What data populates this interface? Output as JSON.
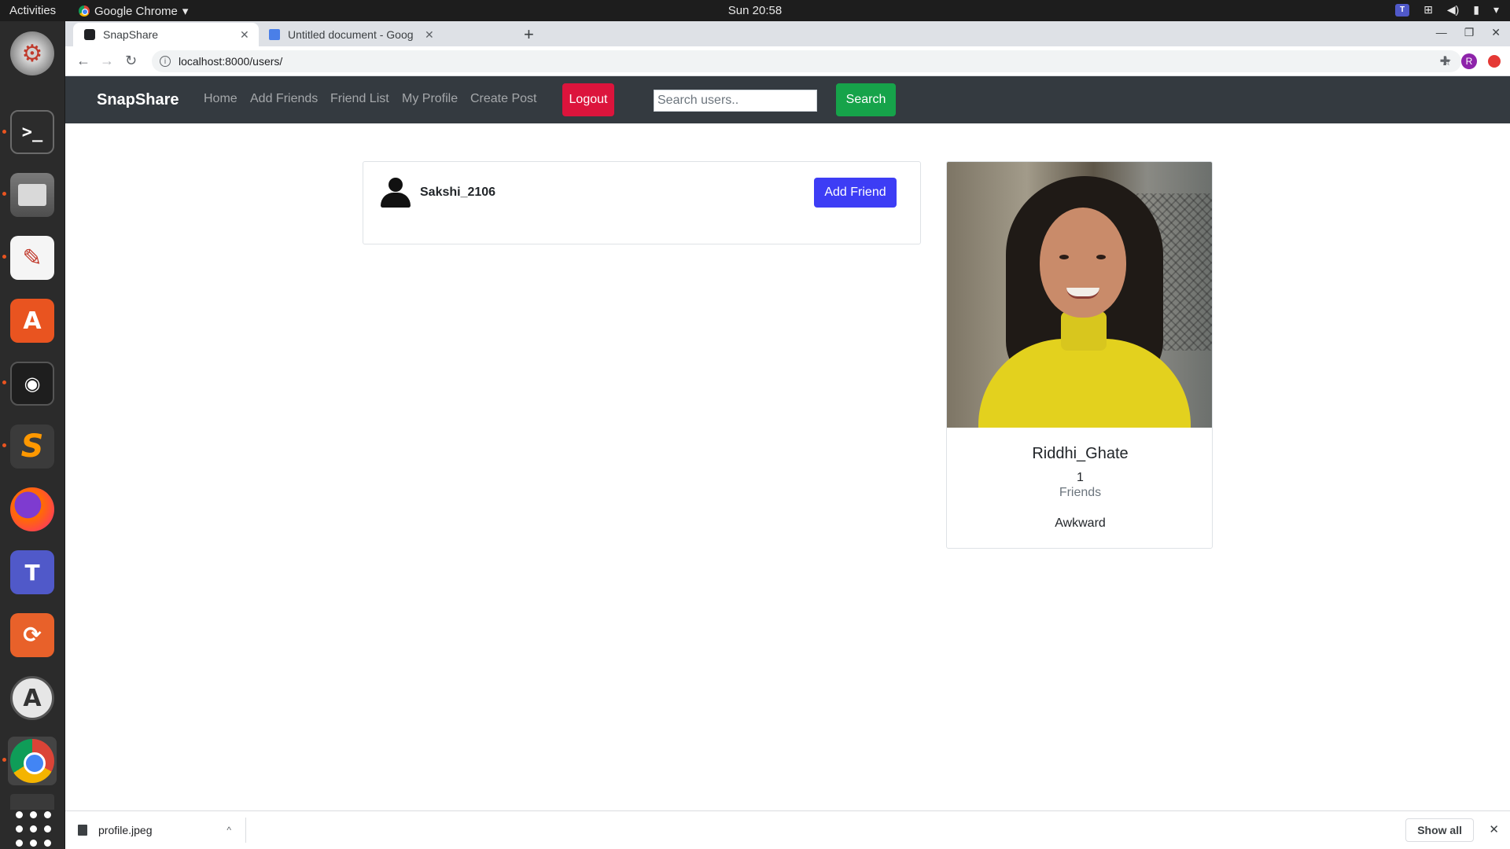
{
  "system": {
    "activities": "Activities",
    "app_menu": "Google Chrome",
    "clock": "Sun 20:58"
  },
  "dock": {
    "items": [
      "settings",
      "terminal",
      "files",
      "text-editor",
      "ubuntu-software",
      "safe",
      "sublime-text",
      "firefox",
      "teams-preview",
      "pdf-editor",
      "software-updater",
      "chrome",
      "trash"
    ]
  },
  "browser": {
    "tabs": [
      {
        "title": "SnapShare",
        "active": true
      },
      {
        "title": "Untitled document - Goog",
        "active": false
      }
    ],
    "url": "localhost:8000/users/",
    "profile_initial": "R"
  },
  "site": {
    "brand": "SnapShare",
    "nav": [
      "Home",
      "Add Friends",
      "Friend List",
      "My Profile",
      "Create Post"
    ],
    "logout_label": "Logout",
    "search_placeholder": "Search users..",
    "search_label": "Search"
  },
  "results": [
    {
      "username": "Sakshi_2106",
      "action_label": "Add Friend"
    }
  ],
  "profile_card": {
    "name": "Riddhi_Ghate",
    "friend_count": "1",
    "friend_label": "Friends",
    "bio": "Awkward"
  },
  "downloads": {
    "file": "profile.jpeg",
    "show_all_label": "Show all"
  },
  "colors": {
    "navbar": "#343a40",
    "logout": "#dc143c",
    "search_button": "#16a34a",
    "add_friend_button": "#3d3df5"
  }
}
